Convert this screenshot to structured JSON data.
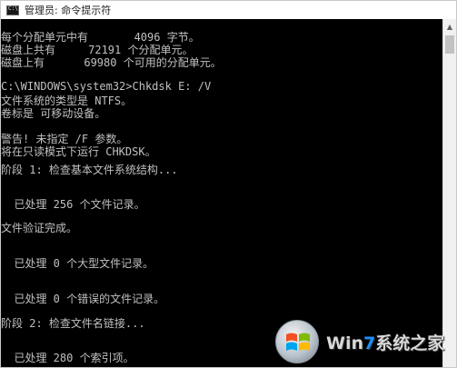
{
  "window": {
    "title": "管理员: 命令提示符"
  },
  "console": {
    "lines": [
      "每个分配单元中有       4096 字节。",
      "磁盘上共有     72191 个分配单元。",
      "磁盘上有      69980 个可用的分配单元。",
      "",
      "C:\\WINDOWS\\system32>Chkdsk E: /V",
      "文件系统的类型是 NTFS。",
      "卷标是 可移动设备。",
      "",
      "警告! 未指定 /F 参数。",
      "将在只读模式下运行 CHKDSK。",
      "",
      "阶段 1: 检查基本文件系统结构...",
      "",
      "",
      "  已处理 256 个文件记录。",
      "",
      "文件验证完成。",
      "",
      "",
      "  已处理 0 个大型文件记录。",
      "",
      "",
      "  已处理 0 个错误的文件记录。",
      "",
      "阶段 2: 检查文件名链接...",
      "",
      "",
      "  已处理 280 个索引项。"
    ]
  },
  "watermark": {
    "text_prefix": "Win",
    "text_seven": "7",
    "text_suffix": "系统之家"
  },
  "colors": {
    "console_bg": "#000000",
    "console_fg": "#c0c0c0",
    "titlebar_bg": "#ffffff"
  },
  "icons": {
    "app": "console-icon",
    "scroll_up": "arrow-up-icon",
    "logo": "windows-logo-icon"
  }
}
